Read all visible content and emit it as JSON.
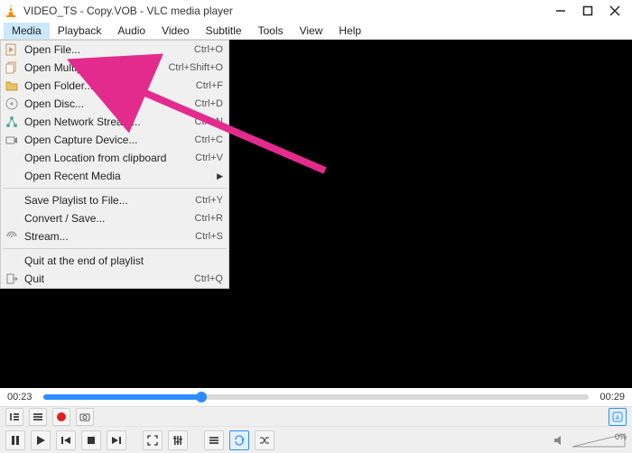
{
  "window": {
    "title": "VIDEO_TS - Copy.VOB - VLC media player"
  },
  "menubar": {
    "items": [
      "Media",
      "Playback",
      "Audio",
      "Video",
      "Subtitle",
      "Tools",
      "View",
      "Help"
    ],
    "open_index": 0
  },
  "media_menu": {
    "sections": [
      [
        {
          "icon": "file-play-icon",
          "label": "Open File...",
          "shortcut": "Ctrl+O"
        },
        {
          "icon": "files-icon",
          "label": "Open Multiple Files...",
          "shortcut": "Ctrl+Shift+O"
        },
        {
          "icon": "folder-icon",
          "label": "Open Folder...",
          "shortcut": "Ctrl+F"
        },
        {
          "icon": "disc-icon",
          "label": "Open Disc...",
          "shortcut": "Ctrl+D"
        },
        {
          "icon": "network-icon",
          "label": "Open Network Stream...",
          "shortcut": "Ctrl+N"
        },
        {
          "icon": "capture-icon",
          "label": "Open Capture Device...",
          "shortcut": "Ctrl+C"
        },
        {
          "icon": "",
          "label": "Open Location from clipboard",
          "shortcut": "Ctrl+V"
        },
        {
          "icon": "",
          "label": "Open Recent Media",
          "submenu": true
        }
      ],
      [
        {
          "icon": "",
          "label": "Save Playlist to File...",
          "shortcut": "Ctrl+Y"
        },
        {
          "icon": "",
          "label": "Convert / Save...",
          "shortcut": "Ctrl+R"
        },
        {
          "icon": "stream-icon",
          "label": "Stream...",
          "shortcut": "Ctrl+S"
        }
      ],
      [
        {
          "icon": "",
          "label": "Quit at the end of playlist"
        },
        {
          "icon": "quit-icon",
          "label": "Quit",
          "shortcut": "Ctrl+Q"
        }
      ]
    ]
  },
  "playback": {
    "elapsed": "00:23",
    "total": "00:29",
    "progress_pct": 29,
    "volume_pct": "0%"
  },
  "annotation": {
    "arrow_color": "#e32b8e"
  }
}
